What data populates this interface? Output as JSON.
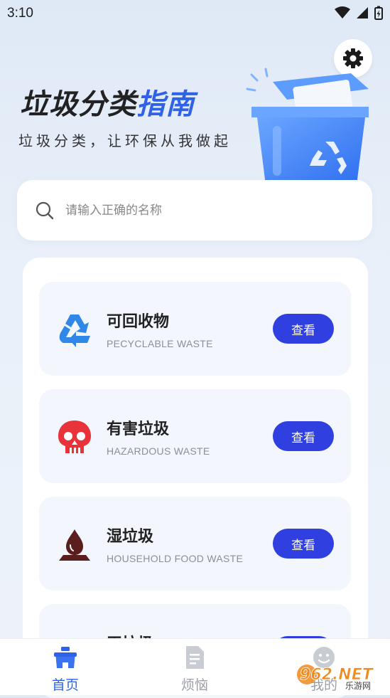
{
  "status_bar": {
    "time": "3:10"
  },
  "hero": {
    "title_part1": "垃圾分类",
    "title_part2": "指南",
    "subtitle": "垃圾分类，让环保从我做起"
  },
  "search": {
    "placeholder": "请输入正确的名称"
  },
  "categories": [
    {
      "title": "可回收物",
      "subtitle": "PECYCLABLE WASTE",
      "button": "查看",
      "icon": "recycle-icon",
      "color": "#2f87e8"
    },
    {
      "title": "有害垃圾",
      "subtitle": "HAZARDOUS WASTE",
      "button": "查看",
      "icon": "skull-icon",
      "color": "#e8333a"
    },
    {
      "title": "湿垃圾",
      "subtitle": "HOUSEHOLD FOOD WASTE",
      "button": "查看",
      "icon": "drop-icon",
      "color": "#5a1e1e"
    },
    {
      "title": "干垃圾",
      "subtitle": "",
      "button": "查看",
      "icon": "dry-waste-icon",
      "color": "#222222"
    }
  ],
  "tabs": [
    {
      "label": "首页",
      "icon": "home-icon",
      "active": true
    },
    {
      "label": "烦恼",
      "icon": "document-icon",
      "active": false
    },
    {
      "label": "我的",
      "icon": "profile-icon",
      "active": false
    }
  ],
  "watermark": {
    "text": "962.NET",
    "subtext": "乐游网"
  },
  "colors": {
    "accent": "#2f62e6",
    "button": "#2f3fe0",
    "card_bg": "#f3f6fd"
  }
}
